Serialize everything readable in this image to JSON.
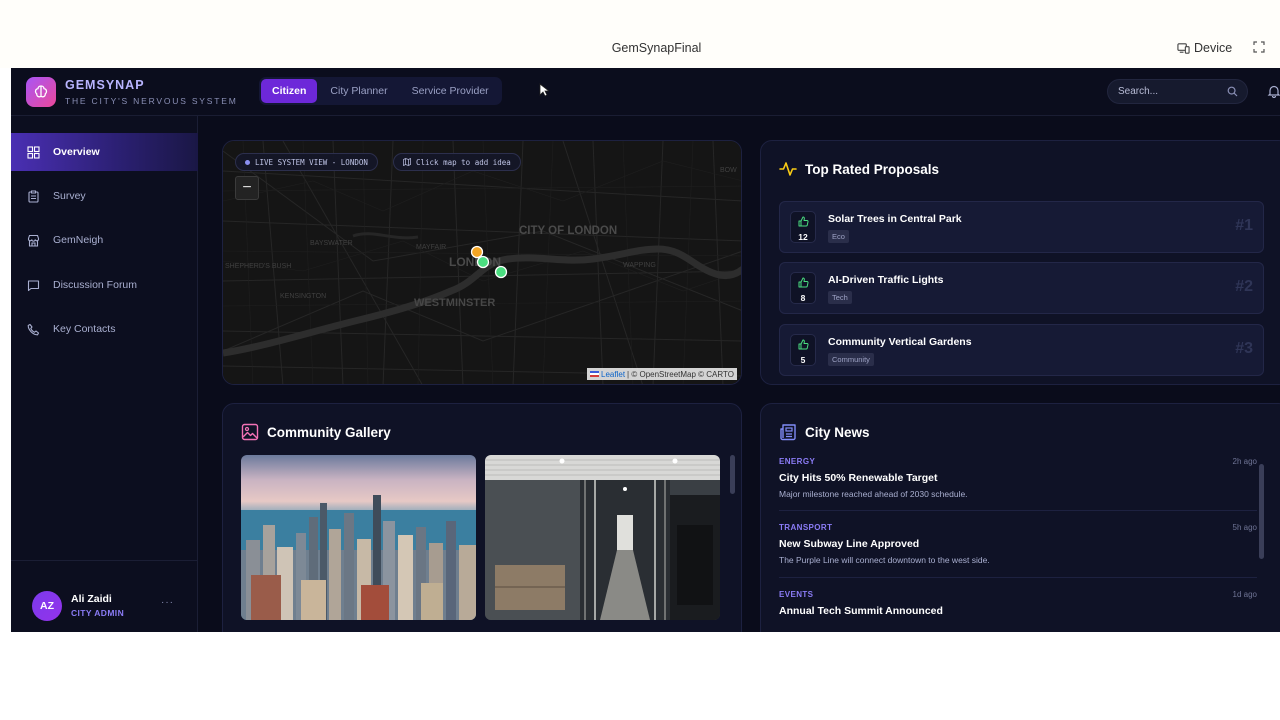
{
  "preview": {
    "title": "GemSynapFinal",
    "device_label": "Device"
  },
  "brand": {
    "name_part1": "GEM",
    "name_part2": "SYNAP",
    "tagline": "THE CITY'S NERVOUS SYSTEM",
    "accent": "#6d28d9"
  },
  "roles": [
    "Citizen",
    "City Planner",
    "Service Provider"
  ],
  "active_role": "Citizen",
  "search": {
    "placeholder": "Search..."
  },
  "sidebar": {
    "items": [
      {
        "label": "Overview",
        "icon": "grid-icon",
        "active": true
      },
      {
        "label": "Survey",
        "icon": "clipboard-icon",
        "active": false
      },
      {
        "label": "GemNeigh",
        "icon": "store-icon",
        "active": false
      },
      {
        "label": "Discussion Forum",
        "icon": "chat-icon",
        "active": false
      },
      {
        "label": "Key Contacts",
        "icon": "phone-icon",
        "active": false
      }
    ],
    "user": {
      "initials": "AZ",
      "name": "Ali Zaidi",
      "role": "CITY ADMIN",
      "more": "···"
    }
  },
  "map": {
    "live_label": "LIVE SYSTEM VIEW - LONDON",
    "hint_label": "Click map to add idea",
    "zoom_out": "−",
    "places": [
      "CITY OF LONDON",
      "LONDON",
      "WESTMINSTER",
      "MAYFAIR",
      "BAYSWATER",
      "KENSINGTON",
      "SHEPHERD'S BUSH",
      "WAPPING",
      "BOW"
    ],
    "attribution_link": "Leaflet",
    "attribution_text": "| © OpenStreetMap © CARTO",
    "markers": [
      "#f5a623",
      "#4ade80",
      "#4ade80"
    ]
  },
  "proposals": {
    "title": "Top Rated Proposals",
    "items": [
      {
        "name": "Solar Trees in Central Park",
        "votes": "12",
        "tag": "Eco",
        "rank": "#1"
      },
      {
        "name": "AI-Driven Traffic Lights",
        "votes": "8",
        "tag": "Tech",
        "rank": "#2"
      },
      {
        "name": "Community Vertical Gardens",
        "votes": "5",
        "tag": "Community",
        "rank": "#3"
      }
    ]
  },
  "gallery": {
    "title": "Community Gallery"
  },
  "news": {
    "title": "City News",
    "items": [
      {
        "category": "ENERGY",
        "time": "2h ago",
        "headline": "City Hits 50% Renewable Target",
        "summary": "Major milestone reached ahead of 2030 schedule."
      },
      {
        "category": "TRANSPORT",
        "time": "5h ago",
        "headline": "New Subway Line Approved",
        "summary": "The Purple Line will connect downtown to the west side."
      },
      {
        "category": "EVENTS",
        "time": "1d ago",
        "headline": "Annual Tech Summit Announced",
        "summary": ""
      }
    ]
  }
}
